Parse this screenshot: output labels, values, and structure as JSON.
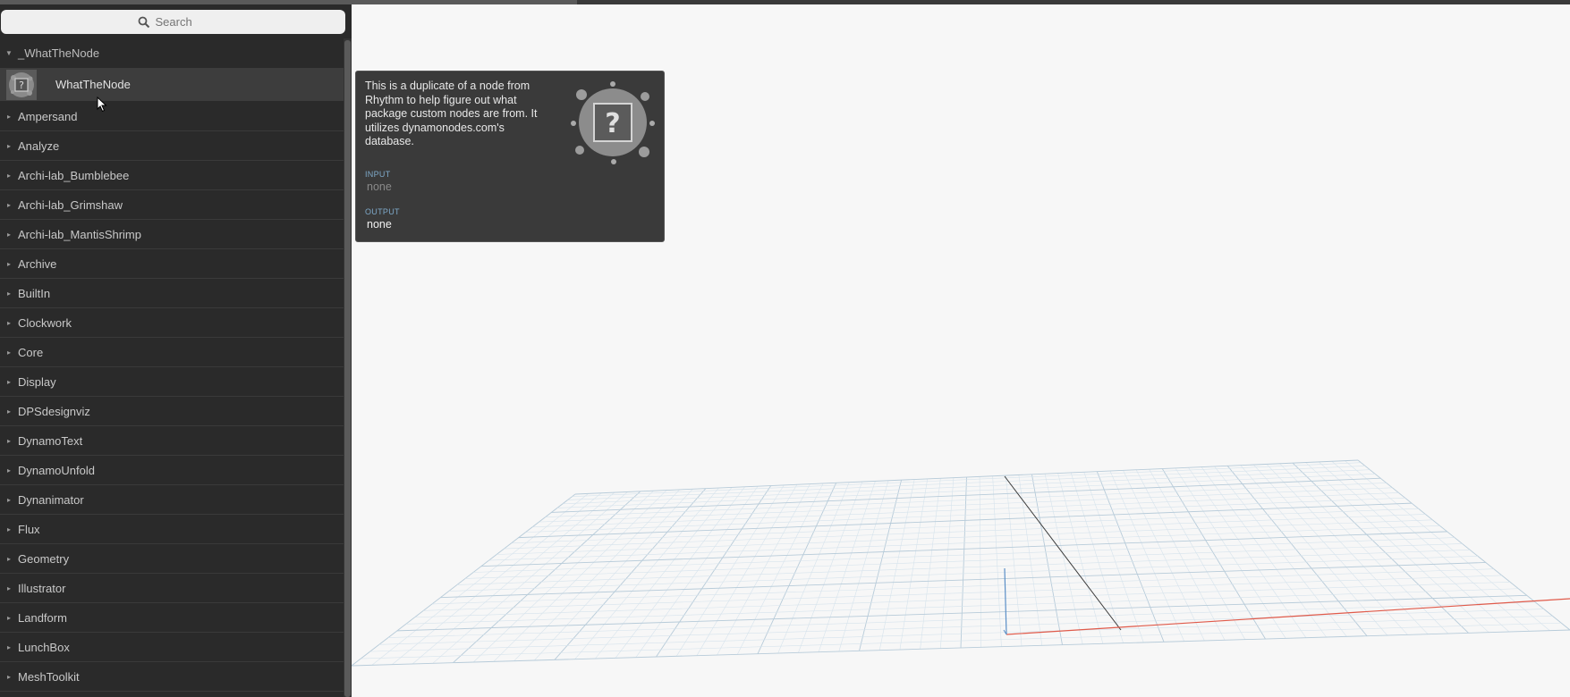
{
  "search": {
    "placeholder": "Search"
  },
  "library": {
    "open_category": "_WhatTheNode",
    "open_items": [
      {
        "label": "WhatTheNode"
      }
    ],
    "categories": [
      "Ampersand",
      "Analyze",
      "Archi-lab_Bumblebee",
      "Archi-lab_Grimshaw",
      "Archi-lab_MantisShrimp",
      "Archive",
      "BuiltIn",
      "Clockwork",
      "Core",
      "Display",
      "DPSdesignviz",
      "DynamoText",
      "DynamoUnfold",
      "Dynanimator",
      "Flux",
      "Geometry",
      "Illustrator",
      "Landform",
      "LunchBox",
      "MeshToolkit"
    ]
  },
  "tooltip": {
    "description": "This is a duplicate of a node from Rhythm to help figure out what package custom nodes are from. It utilizes dynamonodes.com's database.",
    "input_label": "INPUT",
    "input_value": "none",
    "output_label": "OUTPUT",
    "output_value": "none"
  },
  "colors": {
    "sidebar_bg": "#2a2a2a",
    "tooltip_bg": "#3a3a3a",
    "section_label": "#7ea9c9",
    "grid_line": "#c6d9e6",
    "axis_x": "#e05a4a",
    "axis_y": "#3a3a3a",
    "axis_z": "#5b8fc7"
  },
  "icons": {
    "search": "search-icon",
    "node_thumbnail": "whatthenode-icon",
    "cursor": "mouse-pointer-icon",
    "collapsed_arrow": "caret-right-icon",
    "expanded_arrow": "caret-down-icon"
  }
}
